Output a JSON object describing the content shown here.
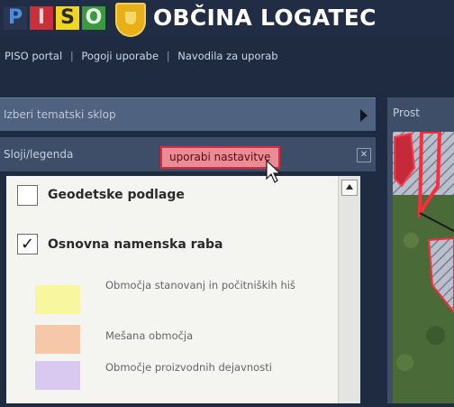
{
  "header": {
    "logo_letters": [
      {
        "char": "P",
        "bg": "#2a3552",
        "fg": "#4b8fe0"
      },
      {
        "char": "I",
        "bg": "#c8303a",
        "fg": "#f4d2d4"
      },
      {
        "char": "S",
        "bg": "#f2d520",
        "fg": "#2a2a2a"
      },
      {
        "char": "O",
        "bg": "#3a9a3e",
        "fg": "#eaf5e6"
      }
    ],
    "crest_icon": "municipality-crest",
    "municipality_name": "OBČINA LOGATEC"
  },
  "nav": {
    "links": [
      "PISO portal",
      "Pogoji uporabe",
      "Navodila za uporab"
    ],
    "separator": "|"
  },
  "panel": {
    "header_label": "Izberi tematski sklop",
    "layers_label": "Sloji/legenda",
    "settings_tab_label": "uporabi nastavitve",
    "close_glyph": "✕",
    "accent_color": "#e02a3c"
  },
  "legend": {
    "groups": [
      {
        "label": "Geodetske podlage",
        "checked": false
      },
      {
        "label": "Osnovna namenska raba",
        "checked": true
      }
    ],
    "items": [
      {
        "label": "Območja stanovanj in počitniških hiš",
        "color": "#f8f7a0"
      },
      {
        "label": "Mešana območja",
        "color": "#f7c7aa"
      },
      {
        "label": "Območje proizvodnih dejavnosti",
        "color": "#d9c9f0"
      }
    ]
  },
  "map": {
    "title": "Prost"
  }
}
